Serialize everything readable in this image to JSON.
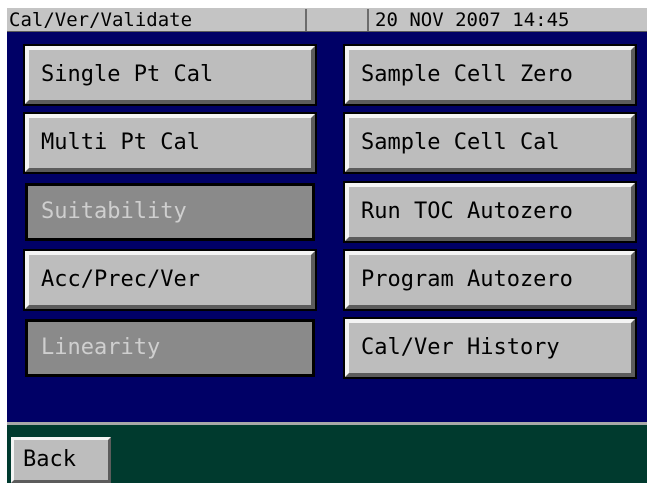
{
  "header": {
    "title": "Cal/Ver/Validate",
    "datetime": "20 NOV 2007 14:45"
  },
  "buttons": {
    "left": [
      {
        "label": "Single Pt Cal",
        "enabled": true
      },
      {
        "label": "Multi Pt Cal",
        "enabled": true
      },
      {
        "label": "Suitability",
        "enabled": false
      },
      {
        "label": "Acc/Prec/Ver",
        "enabled": true
      },
      {
        "label": "Linearity",
        "enabled": false
      }
    ],
    "right": [
      {
        "label": "Sample Cell Zero",
        "enabled": true
      },
      {
        "label": "Sample Cell Cal",
        "enabled": true
      },
      {
        "label": "Run TOC Autozero",
        "enabled": true
      },
      {
        "label": "Program Autozero",
        "enabled": true
      },
      {
        "label": "Cal/Ver History",
        "enabled": true
      }
    ]
  },
  "footer": {
    "back_label": "Back"
  },
  "colors": {
    "screen_background": "#000066",
    "footer_background": "#003a2e",
    "button_face": "#bdbdbd",
    "button_disabled": "#8a8a8a"
  }
}
